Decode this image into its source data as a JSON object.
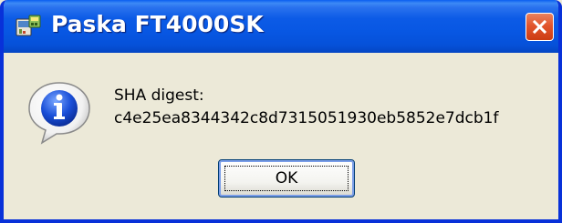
{
  "dialog": {
    "title": "Paska FT4000SK",
    "app_icon": "application-icon",
    "close_icon": "close-icon",
    "message_icon": "info-icon",
    "message_line1": "SHA digest:",
    "message_line2": "c4e25ea8344342c8d7315051930eb5852e7dcb1f",
    "ok_label": "OK"
  },
  "colors": {
    "titlebar": "#0857e3",
    "window_border": "#0831d9",
    "dialog_bg": "#ece9d8",
    "close_button": "#e2552d"
  }
}
